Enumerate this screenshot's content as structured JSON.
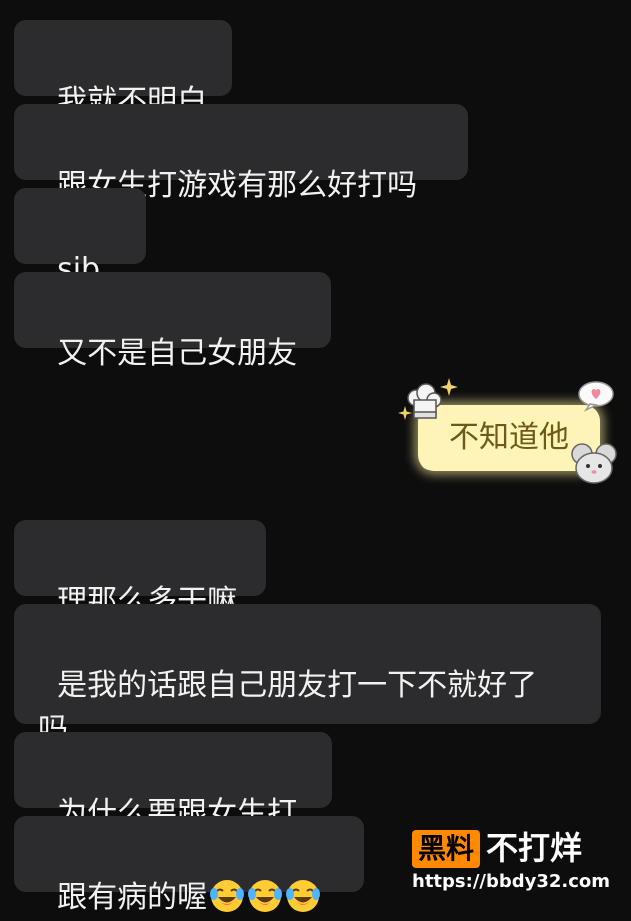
{
  "messages": [
    {
      "text": "我就不明白"
    },
    {
      "text": "跟女生打游戏有那么好打吗"
    },
    {
      "text": "sjb的"
    },
    {
      "text": "又不是自己女朋友"
    },
    {
      "text": "不知道他"
    },
    {
      "text": "理那么多干嘛"
    },
    {
      "text": "是我的话跟自己朋友打一下不就好了\n吗"
    },
    {
      "text": "为什么要跟女生打"
    },
    {
      "text": "跟有病的喔"
    }
  ],
  "icons": {
    "crying_laughing": "crying-laughing-emoji",
    "chef_hat": "chef-hat-icon",
    "mouse": "mouse-sticker-icon",
    "heart_bubble": "heart-bubble-icon",
    "sparkle": "sparkle-icon"
  },
  "colors": {
    "background": "#0d0d0d",
    "received_bubble": "#2c2c2e",
    "received_text": "#f2f2f2",
    "sent_bubble": "#fff4b8",
    "sent_text": "#6b5a1a",
    "watermark_badge": "#ff8a00"
  },
  "watermark": {
    "badge": "黑料",
    "title": "不打烊",
    "url": "https://bbdy32.com"
  }
}
